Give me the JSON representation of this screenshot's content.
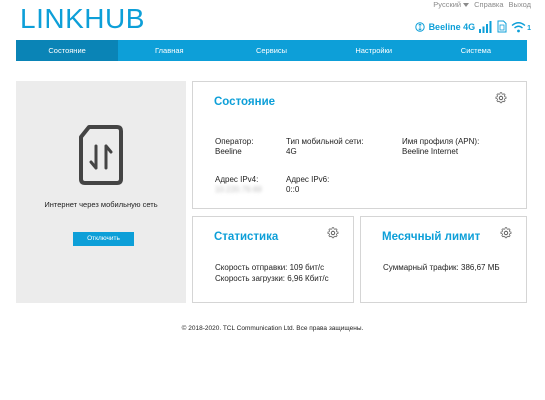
{
  "header": {
    "logo_link": "LINK",
    "logo_hub": "HUB",
    "language": "Русский",
    "help": "Справка",
    "logout": "Выход"
  },
  "status_bar": {
    "carrier": "Beeline 4G",
    "wifi_clients": "1",
    "icons": [
      "roaming-info-icon",
      "signal-icon",
      "sim-icon",
      "wifi-icon"
    ]
  },
  "nav": {
    "items": [
      {
        "label": "Состояние"
      },
      {
        "label": "Главная"
      },
      {
        "label": "Сервисы"
      },
      {
        "label": "Настройки"
      },
      {
        "label": "Система"
      }
    ],
    "active_index": 0
  },
  "connection": {
    "label": "Интернет через мобильную сеть",
    "button": "Отключить"
  },
  "status": {
    "title": "Состояние",
    "operator_label": "Оператор:",
    "operator_value": "Beeline",
    "network_type_label": "Тип мобильной сети:",
    "network_type_value": "4G",
    "apn_label": "Имя профиля (APN):",
    "apn_value": "Beeline Internet",
    "ipv4_label": "Адрес IPv4:",
    "ipv4_value": "10.220.79.69",
    "ipv6_label": "Адрес IPv6:",
    "ipv6_value": "0::0"
  },
  "statistics": {
    "title": "Статистика",
    "upload_speed": "Скорость отправки: 109 бит/с",
    "download_speed": "Скорость загрузки: 6,96 Кбит/с"
  },
  "monthly_limit": {
    "title": "Месячный лимит",
    "total_traffic": "Суммарный трафик: 386,67 МБ"
  },
  "footer": {
    "copyright": "© 2018-2020. TCL Communication Ltd. Все права защищены."
  },
  "colors": {
    "accent": "#0d9fd8",
    "nav_active": "#0a84b6",
    "panel_bg": "#ececec"
  }
}
